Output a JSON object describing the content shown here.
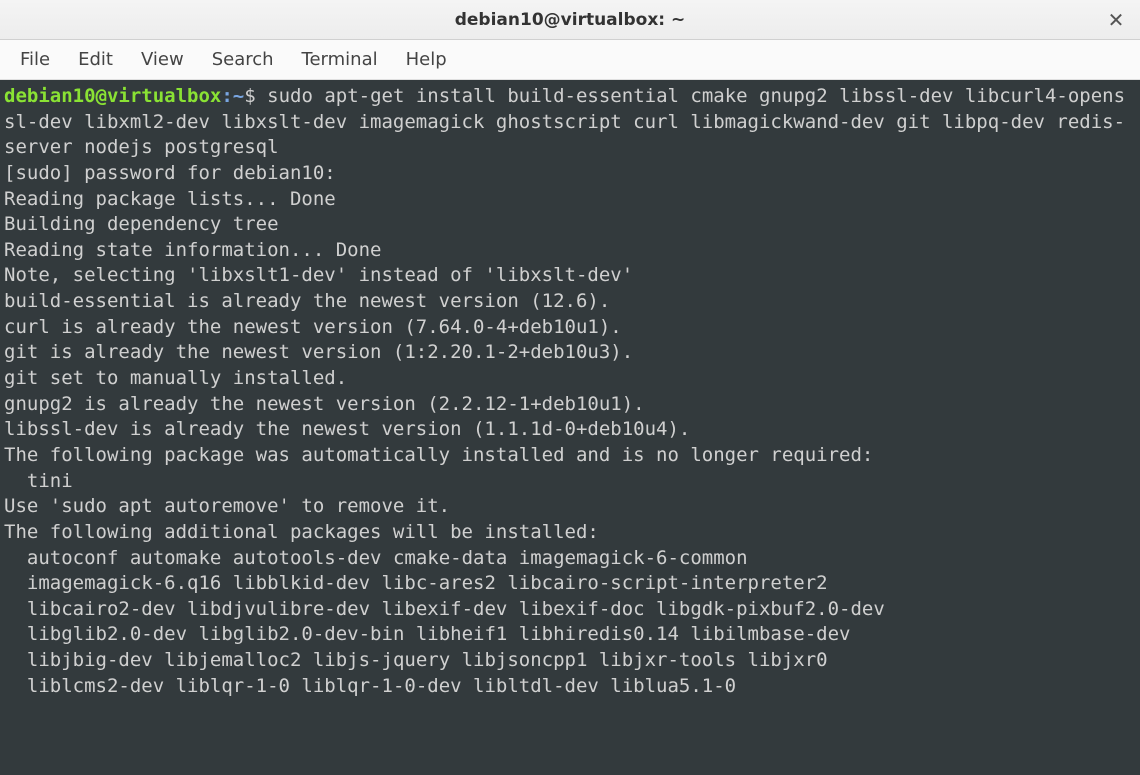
{
  "window": {
    "title": "debian10@virtualbox: ~",
    "close_glyph": "✕"
  },
  "menubar": [
    {
      "label": "File"
    },
    {
      "label": "Edit"
    },
    {
      "label": "View"
    },
    {
      "label": "Search"
    },
    {
      "label": "Terminal"
    },
    {
      "label": "Help"
    }
  ],
  "prompt": {
    "user_host": "debian10@virtualbox",
    "separator": ":",
    "path": "~",
    "sigil": "$ "
  },
  "command": "sudo apt-get install build-essential cmake gnupg2 libssl-dev libcurl4-openssl-dev libxml2-dev libxslt-dev imagemagick ghostscript curl libmagickwand-dev git libpq-dev redis-server nodejs postgresql",
  "output": "[sudo] password for debian10:\nReading package lists... Done\nBuilding dependency tree\nReading state information... Done\nNote, selecting 'libxslt1-dev' instead of 'libxslt-dev'\nbuild-essential is already the newest version (12.6).\ncurl is already the newest version (7.64.0-4+deb10u1).\ngit is already the newest version (1:2.20.1-2+deb10u3).\ngit set to manually installed.\ngnupg2 is already the newest version (2.2.12-1+deb10u1).\nlibssl-dev is already the newest version (1.1.1d-0+deb10u4).\nThe following package was automatically installed and is no longer required:\n  tini\nUse 'sudo apt autoremove' to remove it.\nThe following additional packages will be installed:\n  autoconf automake autotools-dev cmake-data imagemagick-6-common\n  imagemagick-6.q16 libblkid-dev libc-ares2 libcairo-script-interpreter2\n  libcairo2-dev libdjvulibre-dev libexif-dev libexif-doc libgdk-pixbuf2.0-dev\n  libglib2.0-dev libglib2.0-dev-bin libheif1 libhiredis0.14 libilmbase-dev\n  libjbig-dev libjemalloc2 libjs-jquery libjsoncpp1 libjxr-tools libjxr0\n  liblcms2-dev liblqr-1-0 liblqr-1-0-dev libltdl-dev liblua5.1-0"
}
